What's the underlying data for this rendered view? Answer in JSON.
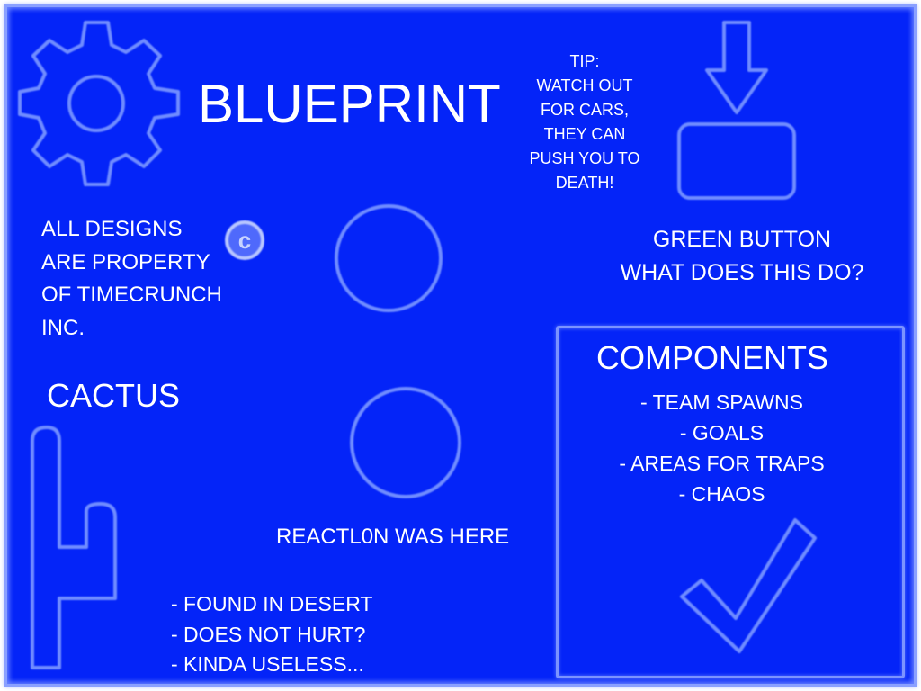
{
  "title": "BLUEPRINT",
  "tip": [
    "TIP:",
    "WATCH OUT",
    "FOR CARS,",
    "THEY CAN",
    "PUSH YOU TO",
    "DEATH!"
  ],
  "green_button": [
    "GREEN BUTTON",
    "WHAT DOES THIS DO?"
  ],
  "copyright": [
    "ALL DESIGNS",
    "ARE PROPERTY",
    "OF TIMECRUNCH",
    "INC."
  ],
  "cactus": {
    "title": "CACTUS",
    "notes": [
      "- FOUND IN DESERT",
      "- DOES NOT HURT?",
      "- KINDA USELESS..."
    ]
  },
  "signature": "REACTL0N WAS HERE",
  "components": {
    "title": "COMPONENTS",
    "items": [
      "- TEAM SPAWNS",
      "- GOALS",
      "- AREAS FOR TRAPS",
      "- CHAOS"
    ]
  },
  "icons": [
    "gear-icon",
    "arrow-down-icon",
    "button-icon",
    "copyright-icon",
    "lever-diagram-icon",
    "cactus-icon",
    "checkmark-icon"
  ],
  "colors": {
    "background": "#0424f8",
    "line_glow": "#6f8cff",
    "text": "#ffffff",
    "border": "#8aa0ff"
  }
}
